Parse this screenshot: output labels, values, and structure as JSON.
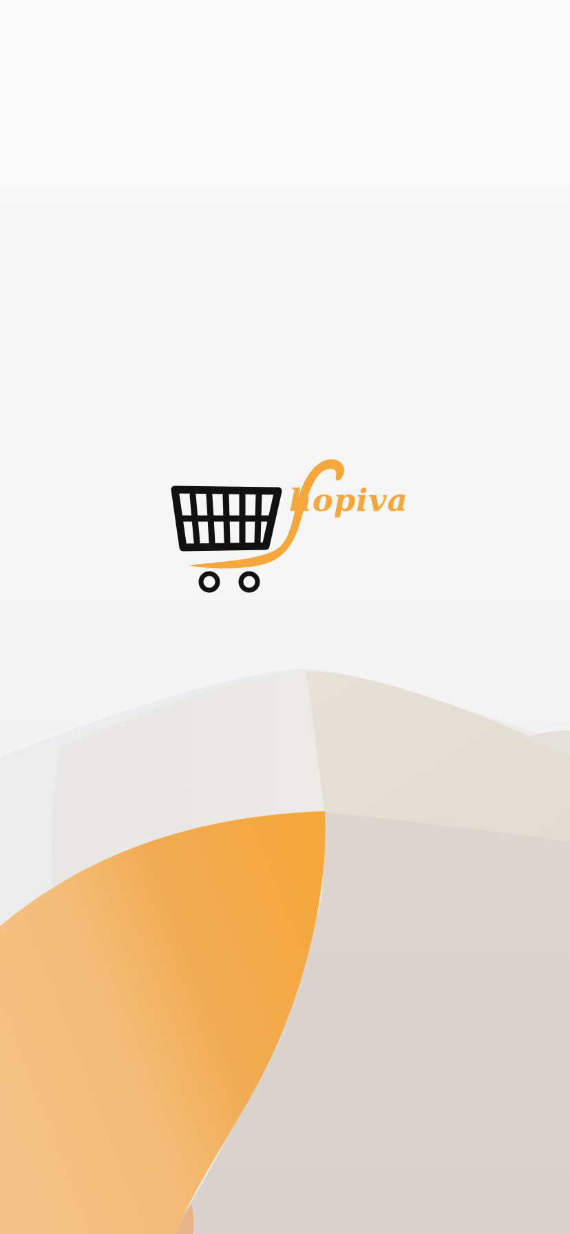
{
  "splash": {
    "brand": {
      "name": "Shopiva",
      "wordmark_suffix": "hopiva",
      "logo_icon": "shopping-cart-icon",
      "colors": {
        "accent": "#f5a73b",
        "ink": "#111111"
      }
    },
    "background": {
      "base": "#f7f7f7",
      "shapes": {
        "orange": "#f3a948",
        "orange_light": "#f4c185",
        "beige": "#e3ddd3",
        "taupe": "#dad3cd",
        "pale": "#ebe9e6"
      }
    }
  }
}
